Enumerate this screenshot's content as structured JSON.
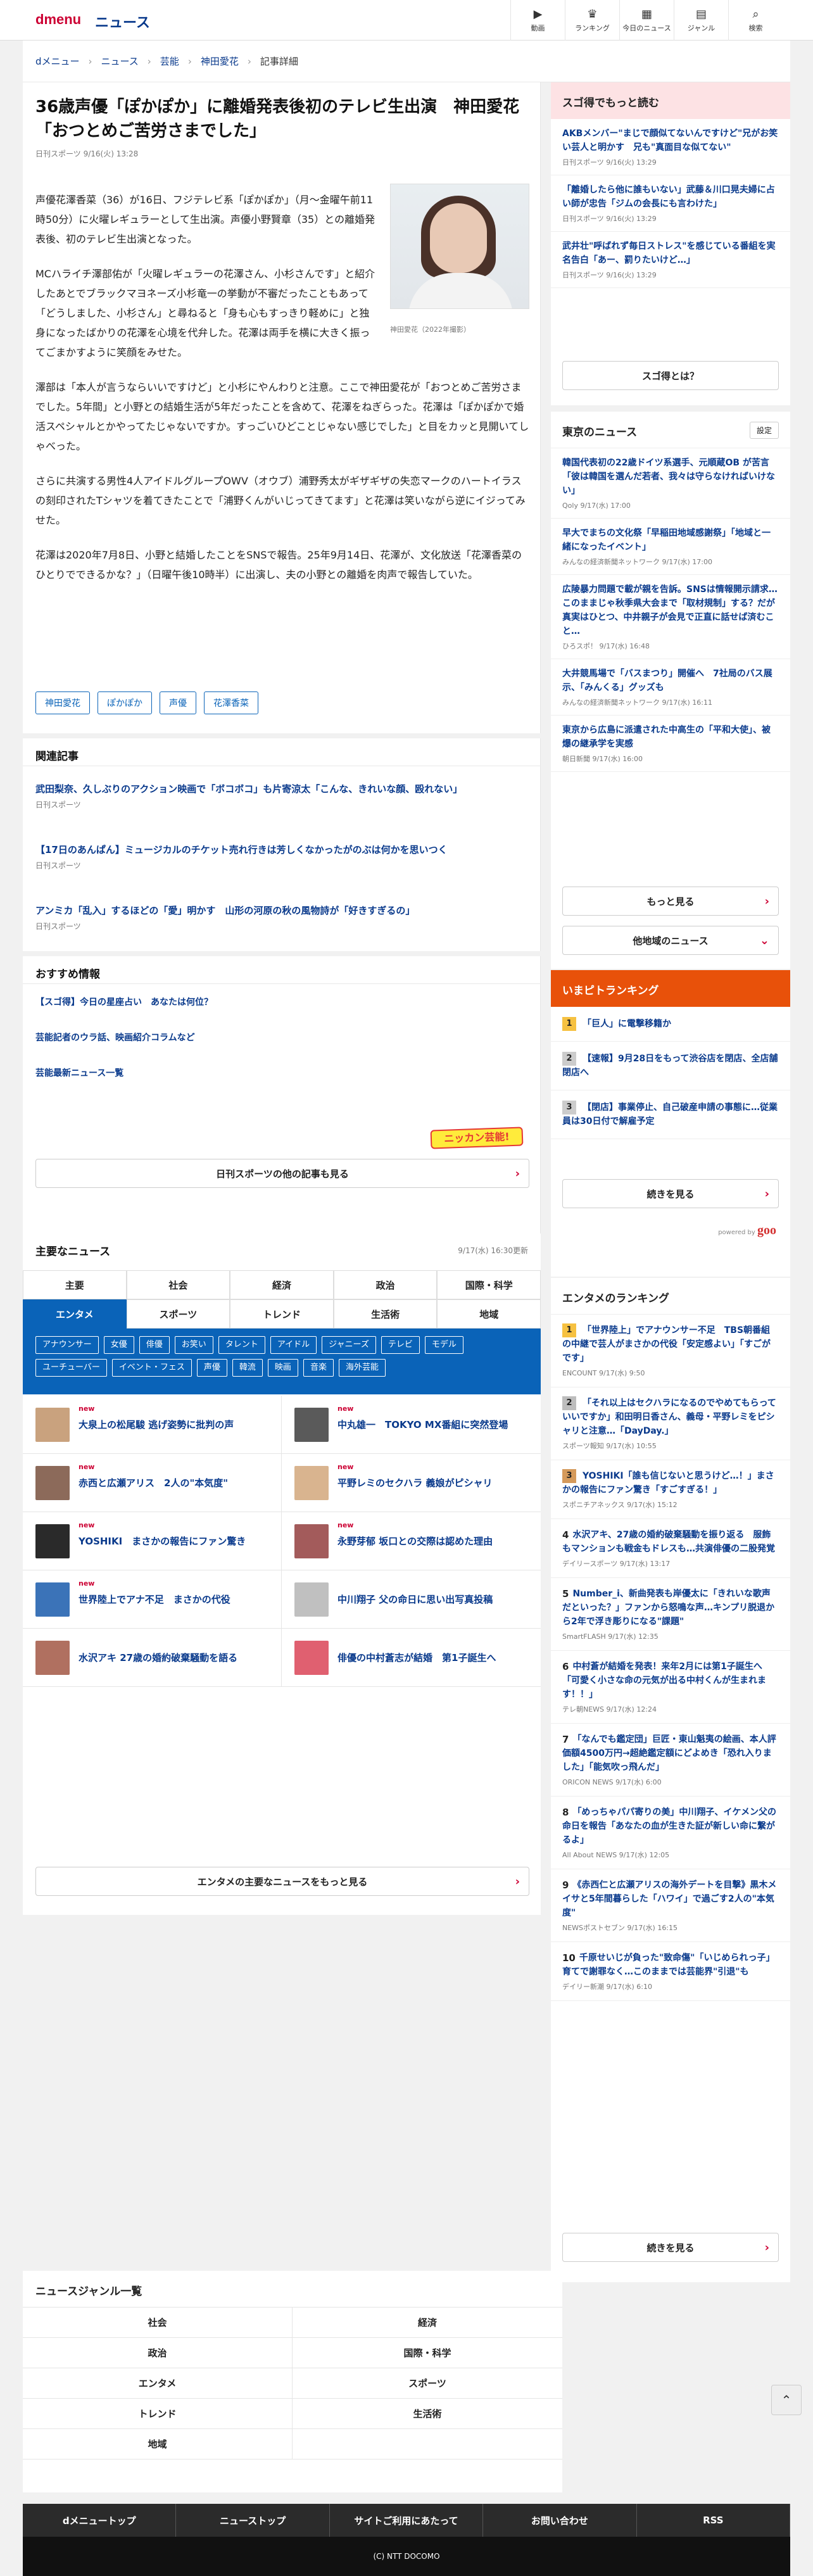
{
  "header": {
    "logo": "dmenu",
    "title": "ニュース",
    "nav": [
      {
        "icon": "video-icon",
        "glyph": "▶",
        "label": "動画"
      },
      {
        "icon": "crown-icon",
        "glyph": "♛",
        "label": "ランキング"
      },
      {
        "icon": "calendar-icon",
        "glyph": "▦",
        "label": "今日のニュース"
      },
      {
        "icon": "grid-icon",
        "glyph": "▤",
        "label": "ジャンル"
      },
      {
        "icon": "search-icon",
        "glyph": "⌕",
        "label": "検索"
      }
    ]
  },
  "breadcrumb": [
    "dメニュー",
    "ニュース",
    "芸能",
    "神田愛花",
    "記事詳細"
  ],
  "article": {
    "title": "36歳声優「ぽかぽか」に離婚発表後初のテレビ生出演　神田愛花「おつとめご苦労さまでした」",
    "meta": "日刊スポーツ 9/16(火) 13:28",
    "image_caption": "神田愛花（2022年撮影）",
    "p1": "声優花澤香菜（36）が16日、フジテレビ系「ぽかぽか」（月～金曜午前11時50分）に火曜レギュラーとして生出演。声優小野賢章（35）との離婚発表後、初のテレビ生出演となった。",
    "p2": "MCハライチ澤部佑が「火曜レギュラーの花澤さん、小杉さんです」と紹介したあとでブラックマヨネーズ小杉竜一の挙動が不審だったこともあって「どうしました、小杉さん」と尋ねると「身も心もすっきり軽めに」と独身になったばかりの花澤を心境を代弁した。花澤は両手を横に大きく振ってごまかすように笑顔をみせた。",
    "p3": "澤部は「本人が言うならいいですけど」と小杉にやんわりと注意。ここで神田愛花が「おつとめご苦労さまでした。5年間」と小野との結婚生活が5年だったことを含めて、花澤をねぎらった。花澤は「ぽかぽかで婚活スペシャルとかやってたじゃないですか。すっごいひどことじゃない感じでした」と目をカッと見開いてしゃべった。",
    "p4": "さらに共演する男性4人アイドルグループOWV（オウブ）浦野秀太がギザギザの失恋マークのハートイラスの刻印されたTシャツを着てきたことで「浦野くんがいじってきてます」と花澤は笑いながら逆にイジってみせた。",
    "p5": "花澤は2020年7月8日、小野と結婚したことをSNSで報告。25年9月14日、花澤が、文化放送「花澤香菜のひとりでできるかな？」（日曜午後10時半）に出演し、夫の小野との離婚を肉声で報告していた。",
    "tags": [
      "神田愛花",
      "ぽかぽか",
      "声優",
      "花澤香菜"
    ]
  },
  "related": {
    "title": "関連記事",
    "items": [
      {
        "title": "武田梨奈、久しぶりのアクション映画で「ボコボコ」も片寄涼太「こんな、きれいな顔、殴れない」",
        "source": "日刊スポーツ"
      },
      {
        "title": "【17日のあんぱん】ミュージカルのチケット売れ行きは芳しくなかったがのぶは何かを思いつく",
        "source": "日刊スポーツ"
      },
      {
        "title": "アンミカ「乱入」するほどの「愛」明かす　山形の河原の秋の風物詩が「好きすぎるの」",
        "source": "日刊スポーツ"
      }
    ]
  },
  "recommend": {
    "title": "おすすめ情報",
    "items": [
      "【スゴ得】今日の星座占い　あなたは何位？",
      "芸能記者のウラ話、映画紹介コラムなど",
      "芸能最新ニュース一覧"
    ],
    "logo": "ニッカン芸能!",
    "more": "日刊スポーツの他の記事も見る"
  },
  "topnews": {
    "title": "主要なニュース",
    "time": "9/17(水) 16:30更新",
    "tabs": [
      "主要",
      "社会",
      "経済",
      "政治",
      "国際・科学",
      "エンタメ",
      "スポーツ",
      "トレンド",
      "生活術",
      "地域"
    ],
    "subtags": [
      "アナウンサー",
      "女優",
      "俳優",
      "お笑い",
      "タレント",
      "アイドル",
      "ジャニーズ",
      "テレビ",
      "モデル",
      "ユーチューバー",
      "イベント・フェス",
      "声優",
      "韓流",
      "映画",
      "音楽",
      "海外芸能"
    ],
    "items": [
      {
        "new": "new",
        "title": "大泉上の松尾駿 逃げ姿勢に批判の声",
        "thumb": "#c9a27e"
      },
      {
        "new": "new",
        "title": "中丸雄一　TOKYO MX番組に突然登場",
        "thumb": "#5a5a5a"
      },
      {
        "new": "new",
        "title": "赤西と広瀬アリス　2人の\"本気度\"",
        "thumb": "#8c6a5a"
      },
      {
        "new": "new",
        "title": "平野レミのセクハラ 義娘がピシャリ",
        "thumb": "#d9b48f"
      },
      {
        "new": "new",
        "title": "YOSHIKI　まさかの報告にファン驚き",
        "thumb": "#2a2a2a"
      },
      {
        "new": "new",
        "title": "永野芽郁 坂口との交際は認めた理由",
        "thumb": "#a35b5b"
      },
      {
        "new": "new",
        "title": "世界陸上でアナ不足　まさかの代役",
        "thumb": "#3b73b8"
      },
      {
        "new": "",
        "title": "中川翔子 父の命日に思い出写真投稿",
        "thumb": "#c0c0c0"
      },
      {
        "new": "",
        "title": "水沢アキ 27歳の婚約破棄騒動を語る",
        "thumb": "#b07060"
      },
      {
        "new": "",
        "title": "俳優の中村蒼志が結婚　第1子誕生へ",
        "thumb": "#e06070"
      }
    ],
    "more": "エンタメの主要なニュースをもっと見る"
  },
  "sugotoku": {
    "title": "スゴ得でもっと読む",
    "items": [
      {
        "title": "AKBメンバー\"まじで顔似てないんですけど\"兄がお笑い芸人と明かす　兄も\"真面目な似てない\"",
        "source": "日刊スポーツ 9/16(火) 13:29"
      },
      {
        "title": "「離婚したら他に誰もいない」武藤＆川口晃夫婦に占い師が忠告「ジムの会長にも言わけた」",
        "source": "日刊スポーツ 9/16(火) 13:29"
      },
      {
        "title": "武井壮\"呼ばれず毎日ストレス\"を感じている番組を実名告白「あー、罰りたいけど…」",
        "source": "日刊スポーツ 9/16(火) 13:29"
      }
    ],
    "button": "スゴ得とは？"
  },
  "tokyo": {
    "title": "東京のニュース",
    "setting": "設定",
    "items": [
      {
        "title": "韓国代表初の22歳ドイツ系選手、元順蔵OB が苦言「彼は韓国を選んだ若者、我々は守らなければいけない」",
        "source": "Qoly 9/17(水) 17:00"
      },
      {
        "title": "早大でまちの文化祭「早稲田地域感謝祭」「地域と一緒になったイベント」",
        "source": "みんなの経済新聞ネットワーク 9/17(水) 17:00"
      },
      {
        "title": "広陵暴力問題で載が親を告訴。SNSは情報開示請求…このままじゃ秋季県大会まで「取材規制」する？だが真実はひとつ、中井親子が会見で正直に話せば済むこと…",
        "source": "ひろスポ！ 9/17(水) 16:48"
      },
      {
        "title": "大井競馬場で「バスまつり」開催へ　7社局のバス展示、「みんくる」グッズも",
        "source": "みんなの経済新聞ネットワーク 9/17(水) 16:11"
      },
      {
        "title": "東京から広島に派遣された中高生の「平和大使」、被爆の継承学を実感",
        "source": "朝日新聞 9/17(水) 16:00"
      }
    ],
    "more": "もっと見る",
    "other": "他地域のニュース"
  },
  "pickup": {
    "title": "いまピトランキング",
    "items": [
      {
        "num": "1",
        "title": "「巨人」に電撃移籍か"
      },
      {
        "num": "2",
        "title": "【速報】9月28日をもって渋谷店を閉店、全店舗閉店へ"
      },
      {
        "num": "3",
        "title": "【閉店】事業停止、自己破産申請の事態に…従業員は30日付で解雇予定"
      }
    ],
    "more": "続きを見る",
    "powered": "goo"
  },
  "entame_rank": {
    "title": "エンタメのランキング",
    "items": [
      {
        "num": "1",
        "title": "「世界陸上」でアナウンサー不足　TBS朝番組の中継で芸人がまさかの代役「安定感よい」「すごがです」",
        "source": "ENCOUNT 9/17(水) 9:50"
      },
      {
        "num": "2",
        "title": "「それ以上はセクハラになるのでやめてもらっていいですか」和田明日香さん、義母・平野レミをピシャリと注意…「DayDay.」",
        "source": "スポーツ報知 9/17(水) 10:55"
      },
      {
        "num": "3",
        "title": "YOSHIKI「誰も信じないと思うけど…！」まさかの報告にファン驚き「すごすぎる！」",
        "source": "スポニチアネックス 9/17(水) 15:12"
      },
      {
        "num": "4",
        "title": "水沢アキ、27歳の婚約破棄騒動を振り返る　服飾もマンションも戦金もドレスも…共演俳優の二股発覚",
        "source": "デイリースポーツ 9/17(水) 13:17"
      },
      {
        "num": "5",
        "title": "Number_i、新曲発表も岸優太に「きれいな歌声だといった？」ファンから怒鳴な声…キンプリ脱退から2年で浮き彫りになる\"課題\"",
        "source": "SmartFLASH 9/17(水) 12:35"
      },
      {
        "num": "6",
        "title": "中村蒼が結婚を発表！来年2月には第1子誕生へ「可愛く小さな命の元気が出る中村くんが生まれます！！」",
        "source": "テレ朝NEWS 9/17(水) 12:24"
      },
      {
        "num": "7",
        "title": "「なんでも鑑定団」巨匠・東山魁夷の絵画、本人評価額4500万円→超絶鑑定額にどよめき「恐れ入りました」「能気吹っ飛んだ」",
        "source": "ORICON NEWS 9/17(水) 6:00"
      },
      {
        "num": "8",
        "title": "「めっちゃパパ寄りの美」中川翔子、イケメン父の命日を報告「あなたの血が生きた証が新しい命に繋がるよ」",
        "source": "All About NEWS 9/17(水) 12:05"
      },
      {
        "num": "9",
        "title": "《赤西仁と広瀬アリスの海外デートを目撃》黒木メイサと5年間暮らした「ハワイ」で過ごす2人の\"本気度\"",
        "source": "NEWSポストセブン 9/17(水) 16:15"
      },
      {
        "num": "10",
        "title": "千原せいじが負った\"致命傷\"「いじめられっ子」育てで謝罪なく…このままでは芸能界\"引退\"も",
        "source": "デイリー新潮 9/17(水) 6:10"
      }
    ],
    "more": "続きを見る"
  },
  "genre": {
    "title": "ニュースジャンル一覧",
    "items": [
      "社会",
      "経済",
      "政治",
      "国際・科学",
      "エンタメ",
      "スポーツ",
      "トレンド",
      "生活術",
      "地域",
      ""
    ]
  },
  "footer": {
    "links": [
      "dメニュートップ",
      "ニューストップ",
      "サイトご利用にあたって",
      "お問い合わせ",
      "RSS"
    ],
    "copyright": "(C) NTT DOCOMO"
  },
  "colors": {
    "brand_red": "#cc0033",
    "link_blue": "#0a3a8c",
    "tab_blue": "#0a63b8",
    "rank_orange": "#e8510a"
  }
}
